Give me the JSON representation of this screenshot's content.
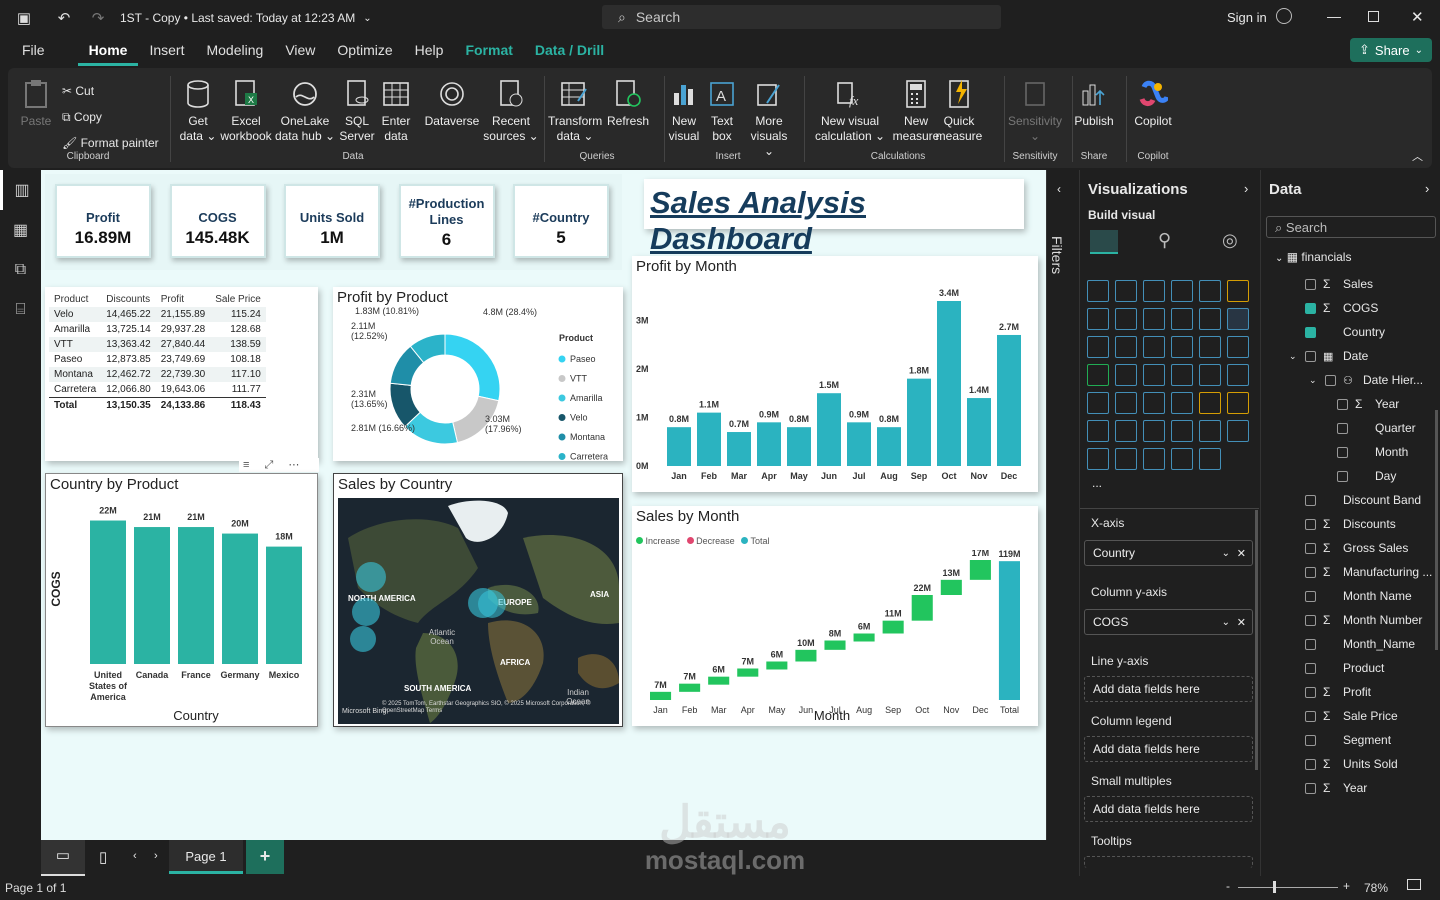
{
  "titlebar": {
    "file_title": "1ST - Copy • Last saved: Today at 12:23 AM",
    "search_placeholder": "Search",
    "signin": "Sign in"
  },
  "menu": {
    "file": "File",
    "home": "Home",
    "insert": "Insert",
    "modeling": "Modeling",
    "view": "View",
    "optimize": "Optimize",
    "help": "Help",
    "format": "Format",
    "data_drill": "Data / Drill",
    "share": "Share"
  },
  "ribbon": {
    "paste": "Paste",
    "cut": "Cut",
    "copy": "Copy",
    "format_painter": "Format painter",
    "clipboard": "Clipboard",
    "get_data": [
      "Get",
      "data ⌄"
    ],
    "excel": [
      "Excel",
      "workbook"
    ],
    "onelake": [
      "OneLake",
      "data hub ⌄"
    ],
    "sql": [
      "SQL",
      "Server"
    ],
    "enter": [
      "Enter",
      "data"
    ],
    "dataverse": [
      "Dataverse",
      ""
    ],
    "recent": [
      "Recent",
      "sources ⌄"
    ],
    "data_group": "Data",
    "transform": [
      "Transform",
      "data ⌄"
    ],
    "refresh": [
      "Refresh",
      ""
    ],
    "queries": "Queries",
    "new_visual": [
      "New",
      "visual"
    ],
    "text_box": [
      "Text",
      "box"
    ],
    "more_visuals": [
      "More",
      "visuals ⌄"
    ],
    "insert_group": "Insert",
    "new_calc": [
      "New visual",
      "calculation ⌄"
    ],
    "new_measure": [
      "New",
      "measure"
    ],
    "quick_measure": [
      "Quick",
      "measure"
    ],
    "calc_group": "Calculations",
    "sensitivity": [
      "Sensitivity",
      "⌄"
    ],
    "sensitivity_group": "Sensitivity",
    "publish": [
      "Publish",
      ""
    ],
    "share_group": "Share",
    "copilot": [
      "Copilot",
      ""
    ],
    "copilot_group": "Copilot"
  },
  "kpis": [
    {
      "label": "Profit",
      "value": "16.89M"
    },
    {
      "label": "COGS",
      "value": "145.48K"
    },
    {
      "label": "Units Sold",
      "value": "1M"
    },
    {
      "label": "#Production Lines",
      "value": "6"
    },
    {
      "label": "#Country",
      "value": "5"
    }
  ],
  "dashboard_title": "Sales Analysis Dashboard",
  "table": {
    "headers": [
      "Product",
      "Discounts",
      "Profit",
      "Sale Price"
    ],
    "rows": [
      [
        "Velo",
        "14,465.22",
        "21,155.89",
        "115.24"
      ],
      [
        "Amarilla",
        "13,725.14",
        "29,937.28",
        "128.68"
      ],
      [
        "VTT",
        "13,363.42",
        "27,840.44",
        "138.59"
      ],
      [
        "Paseo",
        "12,873.85",
        "23,749.69",
        "108.18"
      ],
      [
        "Montana",
        "12,462.72",
        "22,739.30",
        "117.10"
      ],
      [
        "Carretera",
        "12,066.80",
        "19,643.06",
        "111.77"
      ]
    ],
    "total": [
      "Total",
      "13,150.35",
      "24,133.86",
      "118.43"
    ]
  },
  "profit_by_product": {
    "title": "Profit by Product",
    "legend_title": "Product",
    "labels": [
      "4.8M (28.4%)",
      "3.03M (17.96%)",
      "2.81M (16.66%)",
      "2.31M (13.65%)",
      "2.11M (12.52%)",
      "1.83M (10.81%)"
    ]
  },
  "country_by_product": {
    "title": "Country by Product",
    "xlabel": "Country",
    "ylabel": "COGS"
  },
  "sales_by_country": {
    "title": "Sales by Country",
    "map_labels": [
      "NORTH AMERICA",
      "EUROPE",
      "ASIA",
      "Atlantic Ocean",
      "AFRICA",
      "SOUTH AMERICA",
      "Indian Ocean"
    ],
    "credit": "© 2025 TomTom, Earthstar Geographics SIO, © 2025 Microsoft Corporation, © OpenStreetMap Terms",
    "brand": "Microsoft Bing"
  },
  "profit_by_month": {
    "title": "Profit by Month"
  },
  "sales_by_month": {
    "title": "Sales by Month",
    "xlabel": "Month",
    "legend": [
      "Increase",
      "Decrease",
      "Total"
    ]
  },
  "chart_data": [
    {
      "type": "bar",
      "title": "Country by Product",
      "categories": [
        "United States of America",
        "Canada",
        "France",
        "Germany",
        "Mexico"
      ],
      "values": [
        22,
        21,
        21,
        20,
        18
      ],
      "value_labels": [
        "22M",
        "21M",
        "21M",
        "20M",
        "18M"
      ],
      "xlabel": "Country",
      "ylabel": "COGS",
      "color": "#2bb3a3"
    },
    {
      "type": "pie",
      "title": "Profit by Product",
      "categories": [
        "Paseo",
        "VTT",
        "Amarilla",
        "Velo",
        "Montana",
        "Carretera"
      ],
      "values": [
        4.8,
        3.03,
        2.81,
        2.31,
        2.11,
        1.83
      ],
      "colors": [
        "#35d3f2",
        "#c8c8c8",
        "#3cc9e0",
        "#17566a",
        "#1f8ea8",
        "#2bb3c9"
      ]
    },
    {
      "type": "bar",
      "title": "Profit by Month",
      "categories": [
        "Jan",
        "Feb",
        "Mar",
        "Apr",
        "May",
        "Jun",
        "Jul",
        "Aug",
        "Sep",
        "Oct",
        "Nov",
        "Dec"
      ],
      "values": [
        0.8,
        1.1,
        0.7,
        0.9,
        0.8,
        1.5,
        0.9,
        0.8,
        1.8,
        3.4,
        1.4,
        2.7
      ],
      "value_labels": [
        "0.8M",
        "1.1M",
        "0.7M",
        "0.9M",
        "0.8M",
        "1.5M",
        "0.9M",
        "0.8M",
        "1.8M",
        "3.4M",
        "1.4M",
        "2.7M"
      ],
      "yticks": [
        "0M",
        "1M",
        "2M",
        "3M"
      ],
      "ylim": [
        0,
        3.4
      ],
      "color": "#2bb3c0"
    },
    {
      "type": "bar",
      "title": "Sales by Month",
      "categories": [
        "Jan",
        "Feb",
        "Mar",
        "Apr",
        "May",
        "Jun",
        "Jul",
        "Aug",
        "Sep",
        "Oct",
        "Nov",
        "Dec",
        "Total"
      ],
      "values": [
        7,
        7,
        6,
        7,
        6,
        10,
        8,
        6,
        11,
        22,
        13,
        17,
        119
      ],
      "value_labels": [
        "7M",
        "7M",
        "6M",
        "7M",
        "6M",
        "10M",
        "8M",
        "6M",
        "11M",
        "22M",
        "13M",
        "17M",
        "119M"
      ],
      "xlabel": "Month",
      "legend": [
        "Increase",
        "Decrease",
        "Total"
      ],
      "colors": {
        "Increase": "#22c55e",
        "Decrease": "#e0476f",
        "Total": "#2bb3c0"
      }
    }
  ],
  "filters_label": "Filters",
  "viz": {
    "title": "Visualizations",
    "build": "Build visual",
    "xaxis": "X-axis",
    "xaxis_val": "Country",
    "colaxis": "Column y-axis",
    "colaxis_val": "COGS",
    "lineaxis": "Line y-axis",
    "collegend": "Column legend",
    "smallmult": "Small multiples",
    "tooltips": "Tooltips",
    "add": "Add data fields here",
    "more": "..."
  },
  "data": {
    "title": "Data",
    "search": "Search",
    "table": "financials",
    "fields": [
      {
        "name": "Sales",
        "sigma": true,
        "on": false,
        "indent": 0
      },
      {
        "name": "COGS",
        "sigma": true,
        "on": true,
        "indent": 0
      },
      {
        "name": "Country",
        "sigma": false,
        "on": true,
        "indent": 0
      },
      {
        "name": "Date",
        "sigma": false,
        "on": false,
        "indent": 0
      },
      {
        "name": "Date Hier...",
        "sigma": false,
        "on": false,
        "indent": 1
      },
      {
        "name": "Year",
        "sigma": true,
        "on": false,
        "indent": 2
      },
      {
        "name": "Quarter",
        "sigma": false,
        "on": false,
        "indent": 2
      },
      {
        "name": "Month",
        "sigma": false,
        "on": false,
        "indent": 2
      },
      {
        "name": "Day",
        "sigma": false,
        "on": false,
        "indent": 2
      },
      {
        "name": "Discount Band",
        "sigma": false,
        "on": false,
        "indent": 0
      },
      {
        "name": "Discounts",
        "sigma": true,
        "on": false,
        "indent": 0
      },
      {
        "name": "Gross Sales",
        "sigma": true,
        "on": false,
        "indent": 0
      },
      {
        "name": "Manufacturing ...",
        "sigma": true,
        "on": false,
        "indent": 0
      },
      {
        "name": "Month Name",
        "sigma": false,
        "on": false,
        "indent": 0
      },
      {
        "name": "Month Number",
        "sigma": true,
        "on": false,
        "indent": 0
      },
      {
        "name": "Month_Name",
        "sigma": false,
        "on": false,
        "indent": 0
      },
      {
        "name": "Product",
        "sigma": false,
        "on": false,
        "indent": 0
      },
      {
        "name": "Profit",
        "sigma": true,
        "on": false,
        "indent": 0
      },
      {
        "name": "Sale Price",
        "sigma": true,
        "on": false,
        "indent": 0
      },
      {
        "name": "Segment",
        "sigma": false,
        "on": false,
        "indent": 0
      },
      {
        "name": "Units Sold",
        "sigma": true,
        "on": false,
        "indent": 0
      },
      {
        "name": "Year",
        "sigma": true,
        "on": false,
        "indent": 0
      }
    ]
  },
  "pages": {
    "page1": "Page 1",
    "add": "+"
  },
  "status": {
    "page": "Page 1 of 1",
    "zoom": "78%"
  },
  "watermark": {
    "arabic": "مستقل",
    "latin": "mostaql.com"
  }
}
